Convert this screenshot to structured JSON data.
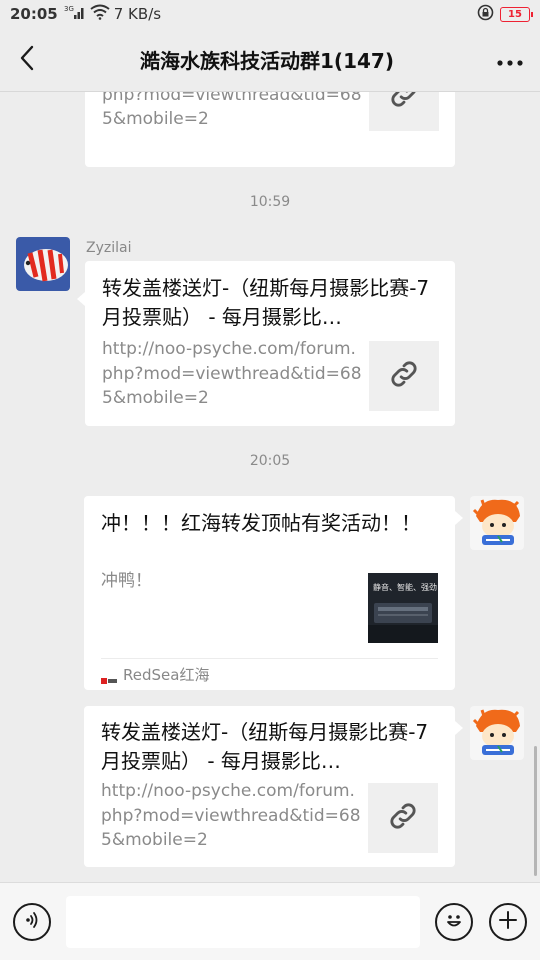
{
  "status_bar": {
    "time": "20:05",
    "signal": "3G",
    "speed": "7 KB/s",
    "battery": "15"
  },
  "header": {
    "title": "澔海水族科技活动群1(147)",
    "back_icon": "chevron-left-icon",
    "more_icon": "more-dots-icon"
  },
  "messages": [
    {
      "type": "link_card",
      "partial": true,
      "desc": "http://noo-psyche.com/forum.php?mod=viewthread&tid=685&mobile=2"
    },
    {
      "type": "timestamp",
      "text": "10:59"
    },
    {
      "type": "link_card",
      "sender": "Zyzilai",
      "title": "转发盖楼送灯-（纽斯每月摄影比赛-7月投票贴） - 每月摄影比…",
      "desc": "http://noo-psyche.com/forum.php?mod=viewthread&tid=685&mobile=2"
    },
    {
      "type": "timestamp",
      "text": "20:05"
    },
    {
      "type": "article_card",
      "title": "冲！！！红海转发顶帖有奖活动！！",
      "desc": "冲鸭！",
      "thumb_text": "静音、智能、强劲",
      "source": "RedSea红海"
    },
    {
      "type": "link_card",
      "title": "转发盖楼送灯-（纽斯每月摄影比赛-7月投票贴） - 每月摄影比…",
      "desc": "http://noo-psyche.com/forum.php?mod=viewthread&tid=685&mobile=2"
    }
  ],
  "input_bar": {
    "voice_icon": "voice-icon",
    "emoji_icon": "emoji-icon",
    "plus_icon": "plus-icon",
    "input_value": ""
  },
  "colors": {
    "background": "#ededed",
    "card": "#ffffff",
    "timestamp": "#8a8a8a",
    "battery": "#e22233"
  }
}
